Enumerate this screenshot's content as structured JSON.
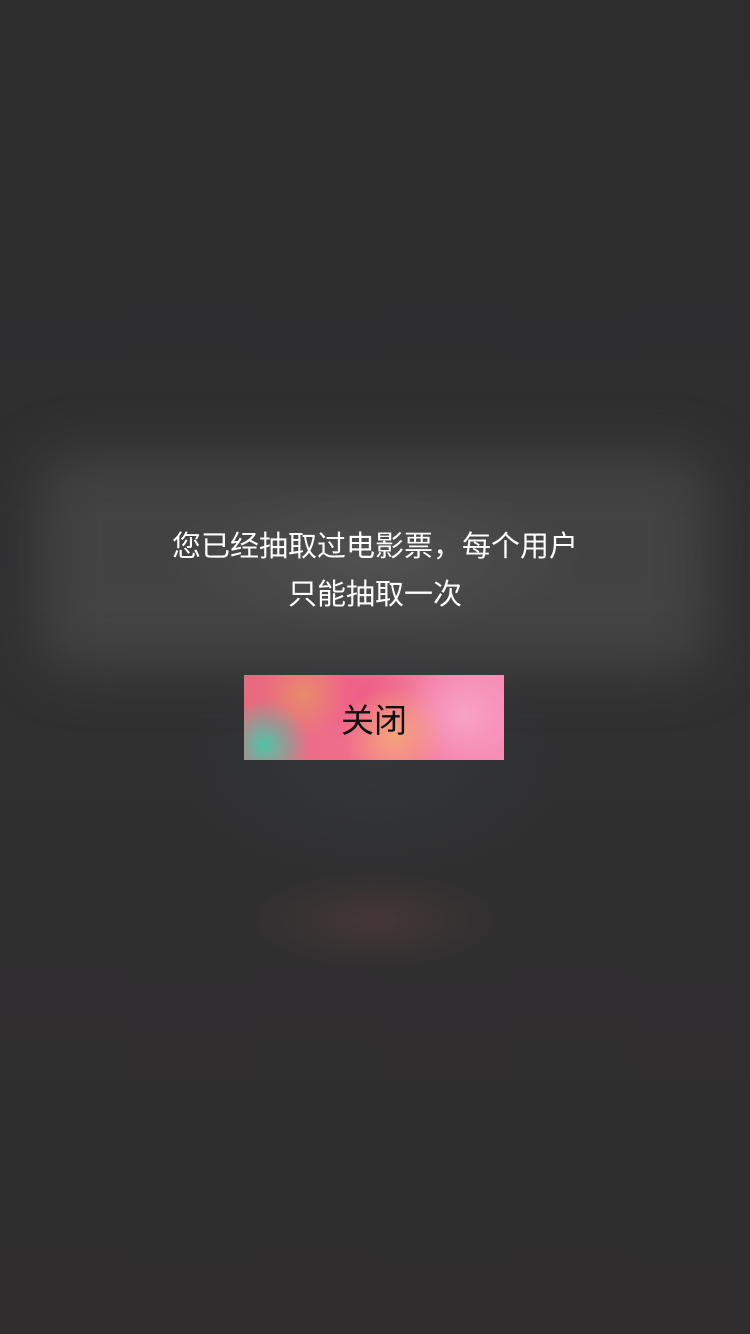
{
  "dialog": {
    "message_line1": "您已经抽取过电影票，每个用户",
    "message_line2": "只能抽取一次",
    "close_label": "关闭"
  },
  "colors": {
    "overlay": "#2f2f30",
    "text": "#ffffff",
    "button_text": "#111111",
    "button_pink": "#f06f8f",
    "button_teal": "#4fc3a8"
  }
}
